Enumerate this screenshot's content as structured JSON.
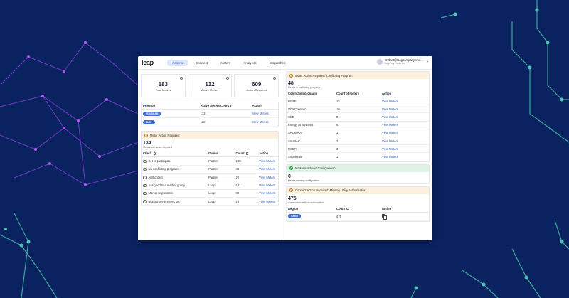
{
  "nav": {
    "logo": "leap",
    "tabs": [
      "Actions",
      "Connect",
      "Meters",
      "Analytics",
      "Dispatches"
    ],
    "active_tab": "Actions",
    "user_email": "firstlast@longcompanyema...",
    "user_org": "LeapFrog Power Inc."
  },
  "stats": [
    {
      "value": "183",
      "label": "Total Meters"
    },
    {
      "value": "132",
      "label": "Active Meters"
    },
    {
      "value": "609",
      "label": "Action Required"
    }
  ],
  "programs": {
    "headers": [
      "Program",
      "Active Meters Count",
      "Action"
    ],
    "rows": [
      {
        "name": "CDA/DRAM",
        "count": "132",
        "action": "View Meters"
      },
      {
        "name": "ELRP",
        "count": "132",
        "action": "View Meters"
      }
    ]
  },
  "meter_action": {
    "banner": "Meter Action Required",
    "count": "134",
    "sub": "Meters with action required",
    "headers": [
      "Check",
      "Owner",
      "Count",
      "Action"
    ],
    "rows": [
      {
        "check": "Set to participate",
        "owner": "Partner",
        "count": "109",
        "action": "View Meters"
      },
      {
        "check": "No conflicting programs",
        "owner": "Partner",
        "count": "48",
        "action": "View Meters"
      },
      {
        "check": "Authorized",
        "owner": "Partner",
        "count": "22",
        "action": "View Meters"
      },
      {
        "check": "Assigned to a market group",
        "owner": "Leap",
        "count": "131",
        "action": "View Meters"
      },
      {
        "check": "Market registration",
        "owner": "Leap",
        "count": "98",
        "action": "View Meters"
      },
      {
        "check": "Bidding preferences set",
        "owner": "Leap",
        "count": "13",
        "action": "View Meters"
      }
    ]
  },
  "conflicting": {
    "banner": "Meter Action Required: Conflicting Program",
    "count": "48",
    "sub": "Meters in conflicting programs",
    "headers": [
      "Conflicting program",
      "Count of meters",
      "Action"
    ],
    "rows": [
      {
        "program": "PG&E",
        "count": "15",
        "action": "View Meters"
      },
      {
        "program": "OhmConnect",
        "count": "10",
        "action": "View Meters"
      },
      {
        "program": "SCE",
        "count": "9",
        "action": "View Meters"
      },
      {
        "program": "Energy AI Systems",
        "count": "5",
        "action": "View Meters"
      },
      {
        "program": "SACSHOT",
        "count": "3",
        "action": "View Meters"
      },
      {
        "program": "SmartAC",
        "count": "3",
        "action": "View Meters"
      },
      {
        "program": "RSDR",
        "count": "2",
        "action": "View Meters"
      },
      {
        "program": "SmartRate",
        "count": "1",
        "action": "View Meters"
      }
    ]
  },
  "no_config": {
    "banner": "No Meters Need Configuration",
    "count": "0",
    "sub": "Meters needing configuration"
  },
  "connect_action": {
    "banner": "Connect Action Required: Missing Utility Authorization",
    "count": "475",
    "sub": "Connections without authorization",
    "headers": [
      "Region",
      "Count",
      "Action"
    ],
    "rows": [
      {
        "region": "CAISO",
        "count": "475"
      }
    ]
  },
  "colors": {
    "background": "#0a2260",
    "accent": "#2b59c3",
    "pill": "#3d6bd8",
    "warn": "#fdf0dc",
    "ok": "#def3e3"
  }
}
